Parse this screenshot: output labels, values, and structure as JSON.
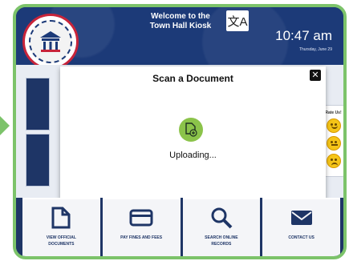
{
  "header": {
    "welcome_line1": "Welcome to the",
    "welcome_line2": "Town Hall Kiosk",
    "translate_icon": "translate-icon",
    "time": "10:47 am",
    "date": "Thursday, June 29"
  },
  "seal": {
    "text": "GOVERNMENT"
  },
  "modal": {
    "title": "Scan a Document",
    "close_label": "✕",
    "status": "Uploading...",
    "icon": "document-upload-icon"
  },
  "rating": {
    "label": "Rate Us!"
  },
  "tiles": [
    {
      "label_line1": "VIEW OFFICIAL",
      "label_line2": "DOCUMENTS",
      "icon": "document-icon"
    },
    {
      "label_line1": "PAY FINES AND FEES",
      "label_line2": "",
      "icon": "credit-card-icon"
    },
    {
      "label_line1": "SEARCH ONLINE",
      "label_line2": "RECORDS",
      "icon": "search-icon"
    },
    {
      "label_line1": "CONTACT US",
      "label_line2": "",
      "icon": "mail-icon"
    }
  ],
  "colors": {
    "frame": "#7cc36a",
    "navy": "#1e3566",
    "accent_green": "#8bc34a"
  }
}
